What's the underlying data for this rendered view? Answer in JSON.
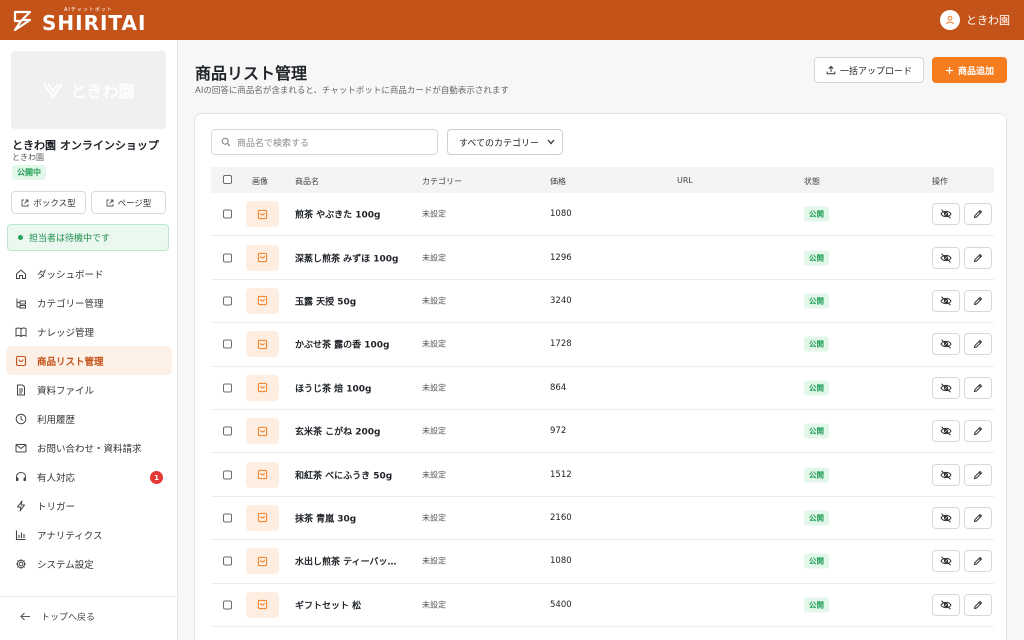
{
  "header": {
    "logo_sub": "AIチャットボット",
    "logo_text": "SHIRITAI",
    "user_name": "ときわ園"
  },
  "sidebar": {
    "card_label": "ときわ園",
    "shop_name": "ときわ園 オンラインショップ",
    "shop_sub": "ときわ園",
    "status_badge": "公開中",
    "box_type": "ボックス型",
    "page_type": "ページ型",
    "operator_status": "担当者は待機中です",
    "items": [
      {
        "label": "ダッシュボード",
        "icon": "home-icon"
      },
      {
        "label": "カテゴリー管理",
        "icon": "category-icon"
      },
      {
        "label": "ナレッジ管理",
        "icon": "book-icon"
      },
      {
        "label": "商品リスト管理",
        "icon": "bag-icon"
      },
      {
        "label": "資料ファイル",
        "icon": "file-icon"
      },
      {
        "label": "利用履歴",
        "icon": "clock-icon"
      },
      {
        "label": "お問い合わせ・資料請求",
        "icon": "mail-icon"
      },
      {
        "label": "有人対応",
        "icon": "headset-icon",
        "badge": "1"
      },
      {
        "label": "トリガー",
        "icon": "bolt-icon"
      },
      {
        "label": "アナリティクス",
        "icon": "chart-icon"
      },
      {
        "label": "システム設定",
        "icon": "gear-icon"
      }
    ],
    "active_index": 3,
    "back_label": "トップへ戻る"
  },
  "main": {
    "title": "商品リスト管理",
    "description": "AIの回答に商品名が含まれると、チャットボットに商品カードが自動表示されます",
    "upload_label": "一括アップロード",
    "add_label": "商品追加",
    "search_placeholder": "商品名で検索する",
    "category_filter": "すべてのカテゴリー",
    "columns": {
      "image": "画像",
      "name": "商品名",
      "category": "カテゴリー",
      "price": "価格",
      "url": "URL",
      "status": "状態",
      "actions": "操作"
    },
    "rows": [
      {
        "name": "煎茶 やぶきた 100g",
        "category": "未設定",
        "price": "1080",
        "url": "",
        "status": "公開"
      },
      {
        "name": "深蒸し煎茶 みずほ 100g",
        "category": "未設定",
        "price": "1296",
        "url": "",
        "status": "公開"
      },
      {
        "name": "玉露 天授 50g",
        "category": "未設定",
        "price": "3240",
        "url": "",
        "status": "公開"
      },
      {
        "name": "かぶせ茶 露の香 100g",
        "category": "未設定",
        "price": "1728",
        "url": "",
        "status": "公開"
      },
      {
        "name": "ほうじ茶 焙 100g",
        "category": "未設定",
        "price": "864",
        "url": "",
        "status": "公開"
      },
      {
        "name": "玄米茶 こがね 200g",
        "category": "未設定",
        "price": "972",
        "url": "",
        "status": "公開"
      },
      {
        "name": "和紅茶 べにふうき 50g",
        "category": "未設定",
        "price": "1512",
        "url": "",
        "status": "公開"
      },
      {
        "name": "抹茶 青嵐 30g",
        "category": "未設定",
        "price": "2160",
        "url": "",
        "status": "公開"
      },
      {
        "name": "水出し煎茶 ティーバッ…",
        "category": "未設定",
        "price": "1080",
        "url": "",
        "status": "公開"
      },
      {
        "name": "ギフトセット 松",
        "category": "未設定",
        "price": "5400",
        "url": "",
        "status": "公開"
      }
    ]
  }
}
